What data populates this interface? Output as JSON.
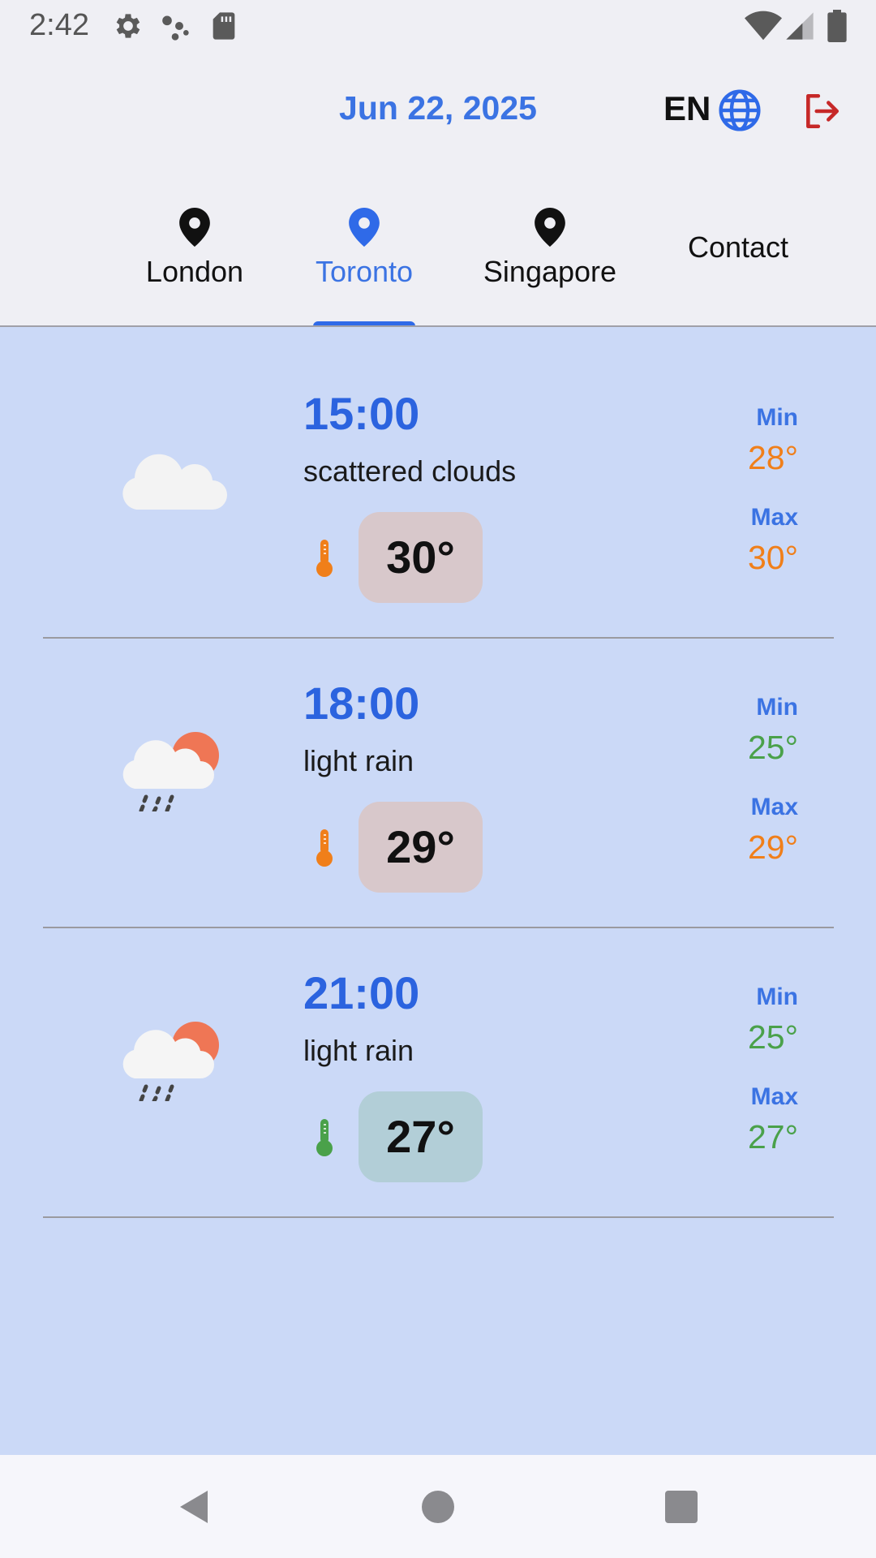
{
  "status_bar": {
    "time": "2:42",
    "icons": [
      "gear-icon",
      "assistant-dots-icon",
      "sd-card-icon",
      "wifi-icon",
      "signal-icon",
      "battery-icon"
    ]
  },
  "header": {
    "date": "Jun 22, 2025",
    "language": "EN",
    "language_icon": "globe-icon",
    "logout_icon": "logout-icon"
  },
  "tabs": [
    {
      "label": "London",
      "icon": "location-pin-icon",
      "active": false
    },
    {
      "label": "Toronto",
      "icon": "location-pin-icon",
      "active": true
    },
    {
      "label": "Singapore",
      "icon": "location-pin-icon",
      "active": false
    },
    {
      "label": "Contact",
      "icon": "",
      "active": false
    }
  ],
  "forecast": [
    {
      "time": "15:00",
      "description": "scattered clouds",
      "icon": "cloud-icon",
      "temp": "30°",
      "min_label": "Min",
      "min": "28°",
      "max_label": "Max",
      "max": "30°"
    },
    {
      "time": "18:00",
      "description": "light rain",
      "icon": "sun-rain-cloud-icon",
      "temp": "29°",
      "min_label": "Min",
      "min": "25°",
      "max_label": "Max",
      "max": "29°"
    },
    {
      "time": "21:00",
      "description": "light rain",
      "icon": "sun-rain-cloud-icon",
      "temp": "27°",
      "min_label": "Min",
      "min": "25°",
      "max_label": "Max",
      "max": "27°"
    }
  ],
  "colors": {
    "accent": "#3b73e3",
    "warm": "#f07f1a",
    "cool": "#4aa14a",
    "warm_badge": "#d8c8cb",
    "cool_badge": "#b2ced7",
    "logout": "#c62828",
    "content_bg": "#cbd9f7"
  },
  "nav_bar": {
    "buttons": [
      "back-icon",
      "home-icon",
      "recents-icon"
    ]
  }
}
